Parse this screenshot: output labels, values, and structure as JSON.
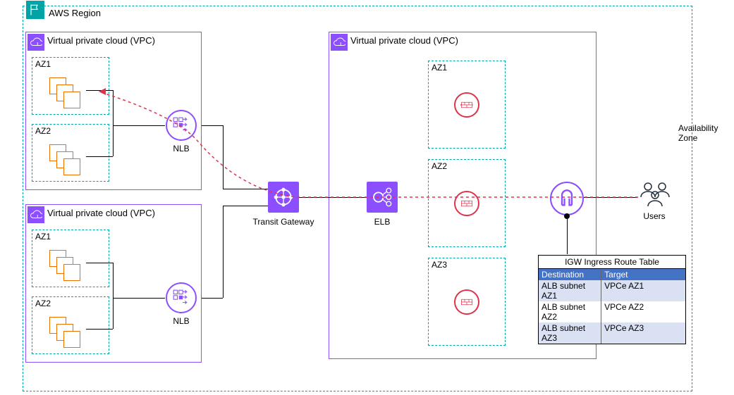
{
  "region": {
    "title": "AWS Region"
  },
  "vpc1": {
    "title": "Virtual private cloud (VPC)",
    "az1": "AZ1",
    "az2": "AZ2",
    "nlb": "NLB"
  },
  "vpc2": {
    "title": "Virtual private cloud (VPC)",
    "az1": "AZ1",
    "az2": "AZ2",
    "nlb": "NLB"
  },
  "vpc3": {
    "title": "Virtual private cloud (VPC)",
    "az1": "AZ1",
    "az2": "AZ2",
    "az3": "AZ3"
  },
  "transit": {
    "label": "Transit Gateway"
  },
  "elb": {
    "label": "ELB"
  },
  "users": {
    "label": "Users"
  },
  "avail_zone": "Availability Zone",
  "table": {
    "title": "IGW Ingress Route Table",
    "headers": {
      "dest": "Destination",
      "target": "Target"
    },
    "rows": [
      {
        "dest": "ALB subnet AZ1",
        "target": "VPCe AZ1"
      },
      {
        "dest": "ALB subnet AZ2",
        "target": "VPCe AZ2"
      },
      {
        "dest": "ALB subnet AZ3",
        "target": "VPCe AZ3"
      }
    ]
  }
}
